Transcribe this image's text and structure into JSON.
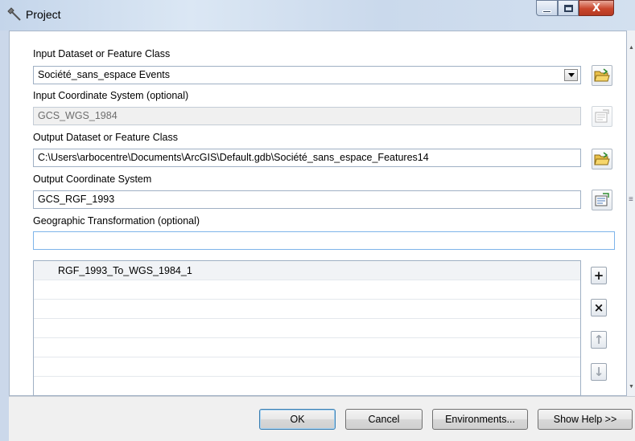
{
  "window": {
    "title": "Project",
    "icon": "hammer-icon",
    "controls": {
      "minimize": "minimize-icon",
      "maximize": "maximize-icon",
      "close": "X"
    }
  },
  "form": {
    "input_dataset": {
      "label": "Input Dataset or Feature Class",
      "value": "Société_sans_espace Events",
      "browse_icon": "folder-open-icon"
    },
    "input_coord": {
      "label": "Input Coordinate System (optional)",
      "value": "GCS_WGS_1984",
      "icon": "spatial-reference-icon"
    },
    "output_dataset": {
      "label": "Output Dataset or Feature Class",
      "value": "C:\\Users\\arbocentre\\Documents\\ArcGIS\\Default.gdb\\Société_sans_espace_Features14",
      "browse_icon": "folder-open-icon"
    },
    "output_coord": {
      "label": "Output Coordinate System",
      "value": "GCS_RGF_1993",
      "icon": "spatial-reference-icon"
    },
    "geo_transform": {
      "label": "Geographic Transformation (optional)",
      "value": ""
    },
    "transform_list": {
      "items": [
        "RGF_1993_To_WGS_1984_1",
        "",
        "",
        "",
        "",
        "",
        ""
      ]
    },
    "list_buttons": {
      "add": "+",
      "remove": "×",
      "up": "↑",
      "down": "↓"
    }
  },
  "footer": {
    "ok": "OK",
    "cancel": "Cancel",
    "environments": "Environments...",
    "show_help": "Show Help >>"
  },
  "colors": {
    "titlebar": "#c4d5ea",
    "close_button": "#c9462c",
    "default_button_border": "#3c7fb1",
    "focus_border": "#7eb4ea"
  }
}
